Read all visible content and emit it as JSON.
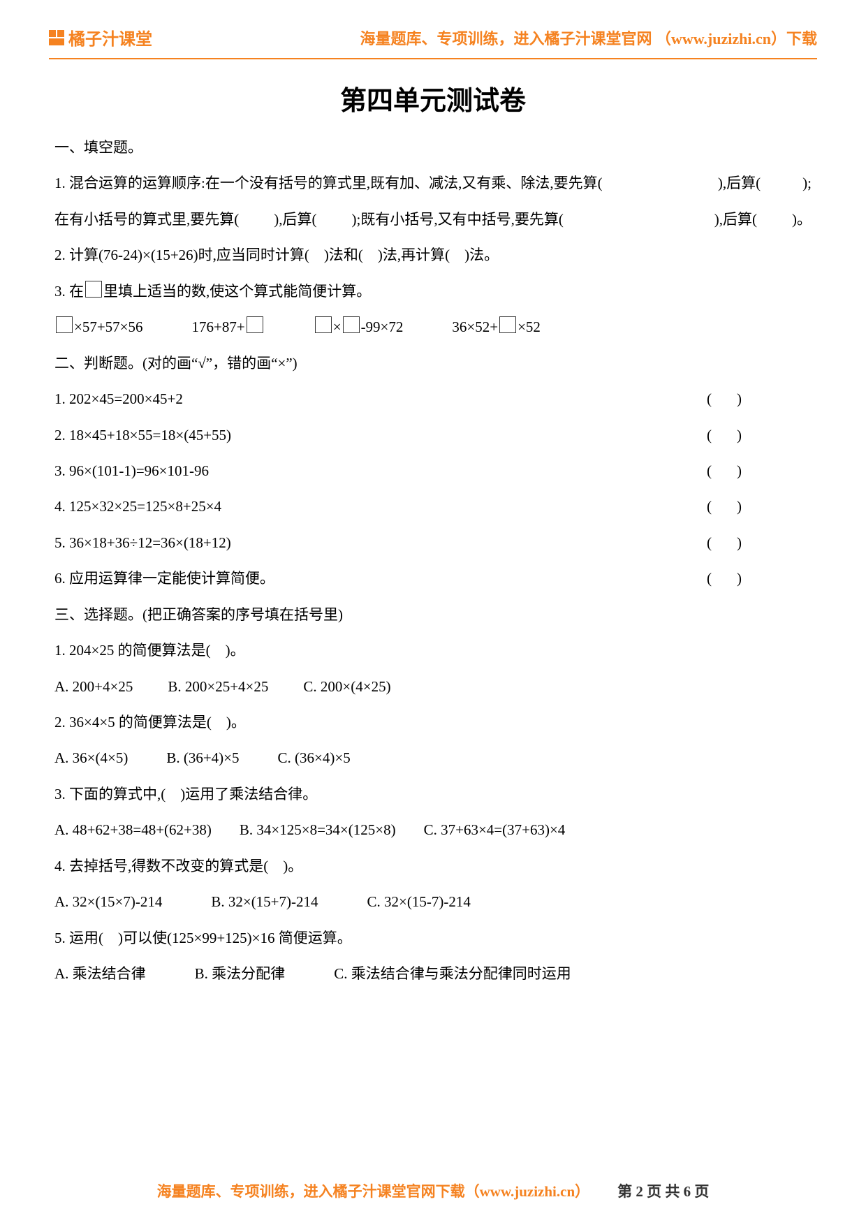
{
  "header": {
    "brand": "橘子汁课堂",
    "tagline": "海量题库、专项训练，进入橘子汁课堂官网 （www.juzizhi.cn）下载"
  },
  "title": "第四单元测试卷",
  "section1": {
    "heading": "一、填空题。",
    "q1_a": "1. 混合运算的运算顺序:在一个没有括号的算式里,既有加、减法,又有乘、除法,要先算(",
    "q1_b": "),后算(",
    "q1_c": ");",
    "q1_d": "在有小括号的算式里,要先算(",
    "q1_e": "),后算(",
    "q1_f": ");既有小括号,又有中括号,要先算(",
    "q1_g": "),后算(",
    "q1_h": ")。",
    "q2": "2. 计算(76-24)×(15+26)时,应当同时计算(　)法和(　)法,再计算(　)法。",
    "q3_intro": "3. 在",
    "q3_rest": "里填上适当的数,使这个算式能简便计算。",
    "q3_e1a": "×57+57×56",
    "q3_e2a": "176+87+",
    "q3_e3a": "×",
    "q3_e3b": "-99×72",
    "q3_e4a": "36×52+",
    "q3_e4b": "×52"
  },
  "section2": {
    "heading": "二、判断题。(对的画“√”，错的画“×”)",
    "q1": "1. 202×45=200×45+2",
    "q2": "2. 18×45+18×55=18×(45+55)",
    "q3": "3. 96×(101-1)=96×101-96",
    "q4": "4. 125×32×25=125×8+25×4",
    "q5": "5. 36×18+36÷12=36×(18+12)",
    "q6": "6. 应用运算律一定能使计算简便。",
    "paren_l": "(",
    "paren_r": ")"
  },
  "section3": {
    "heading": "三、选择题。(把正确答案的序号填在括号里)",
    "q1": "1. 204×25 的简便算法是(　)。",
    "q1a": "A. 200+4×25",
    "q1b": "B. 200×25+4×25",
    "q1c": "C. 200×(4×25)",
    "q2": "2. 36×4×5 的简便算法是(　)。",
    "q2a": "A. 36×(4×5)",
    "q2b": "B. (36+4)×5",
    "q2c": "C. (36×4)×5",
    "q3": "3. 下面的算式中,(　)运用了乘法结合律。",
    "q3a": "A. 48+62+38=48+(62+38)",
    "q3b": "B. 34×125×8=34×(125×8)",
    "q3c": "C. 37+63×4=(37+63)×4",
    "q4": "4. 去掉括号,得数不改变的算式是(　)。",
    "q4a": "A. 32×(15×7)-214",
    "q4b": "B. 32×(15+7)-214",
    "q4c": "C. 32×(15-7)-214",
    "q5": "5. 运用(　)可以使(125×99+125)×16 简便运算。",
    "q5a": "A. 乘法结合律",
    "q5b": "B. 乘法分配律",
    "q5c": "C. 乘法结合律与乘法分配律同时运用"
  },
  "footer": {
    "link": "海量题库、专项训练，进入橘子汁课堂官网下载（www.juzizhi.cn）",
    "pager": "第 2 页 共 6 页"
  }
}
